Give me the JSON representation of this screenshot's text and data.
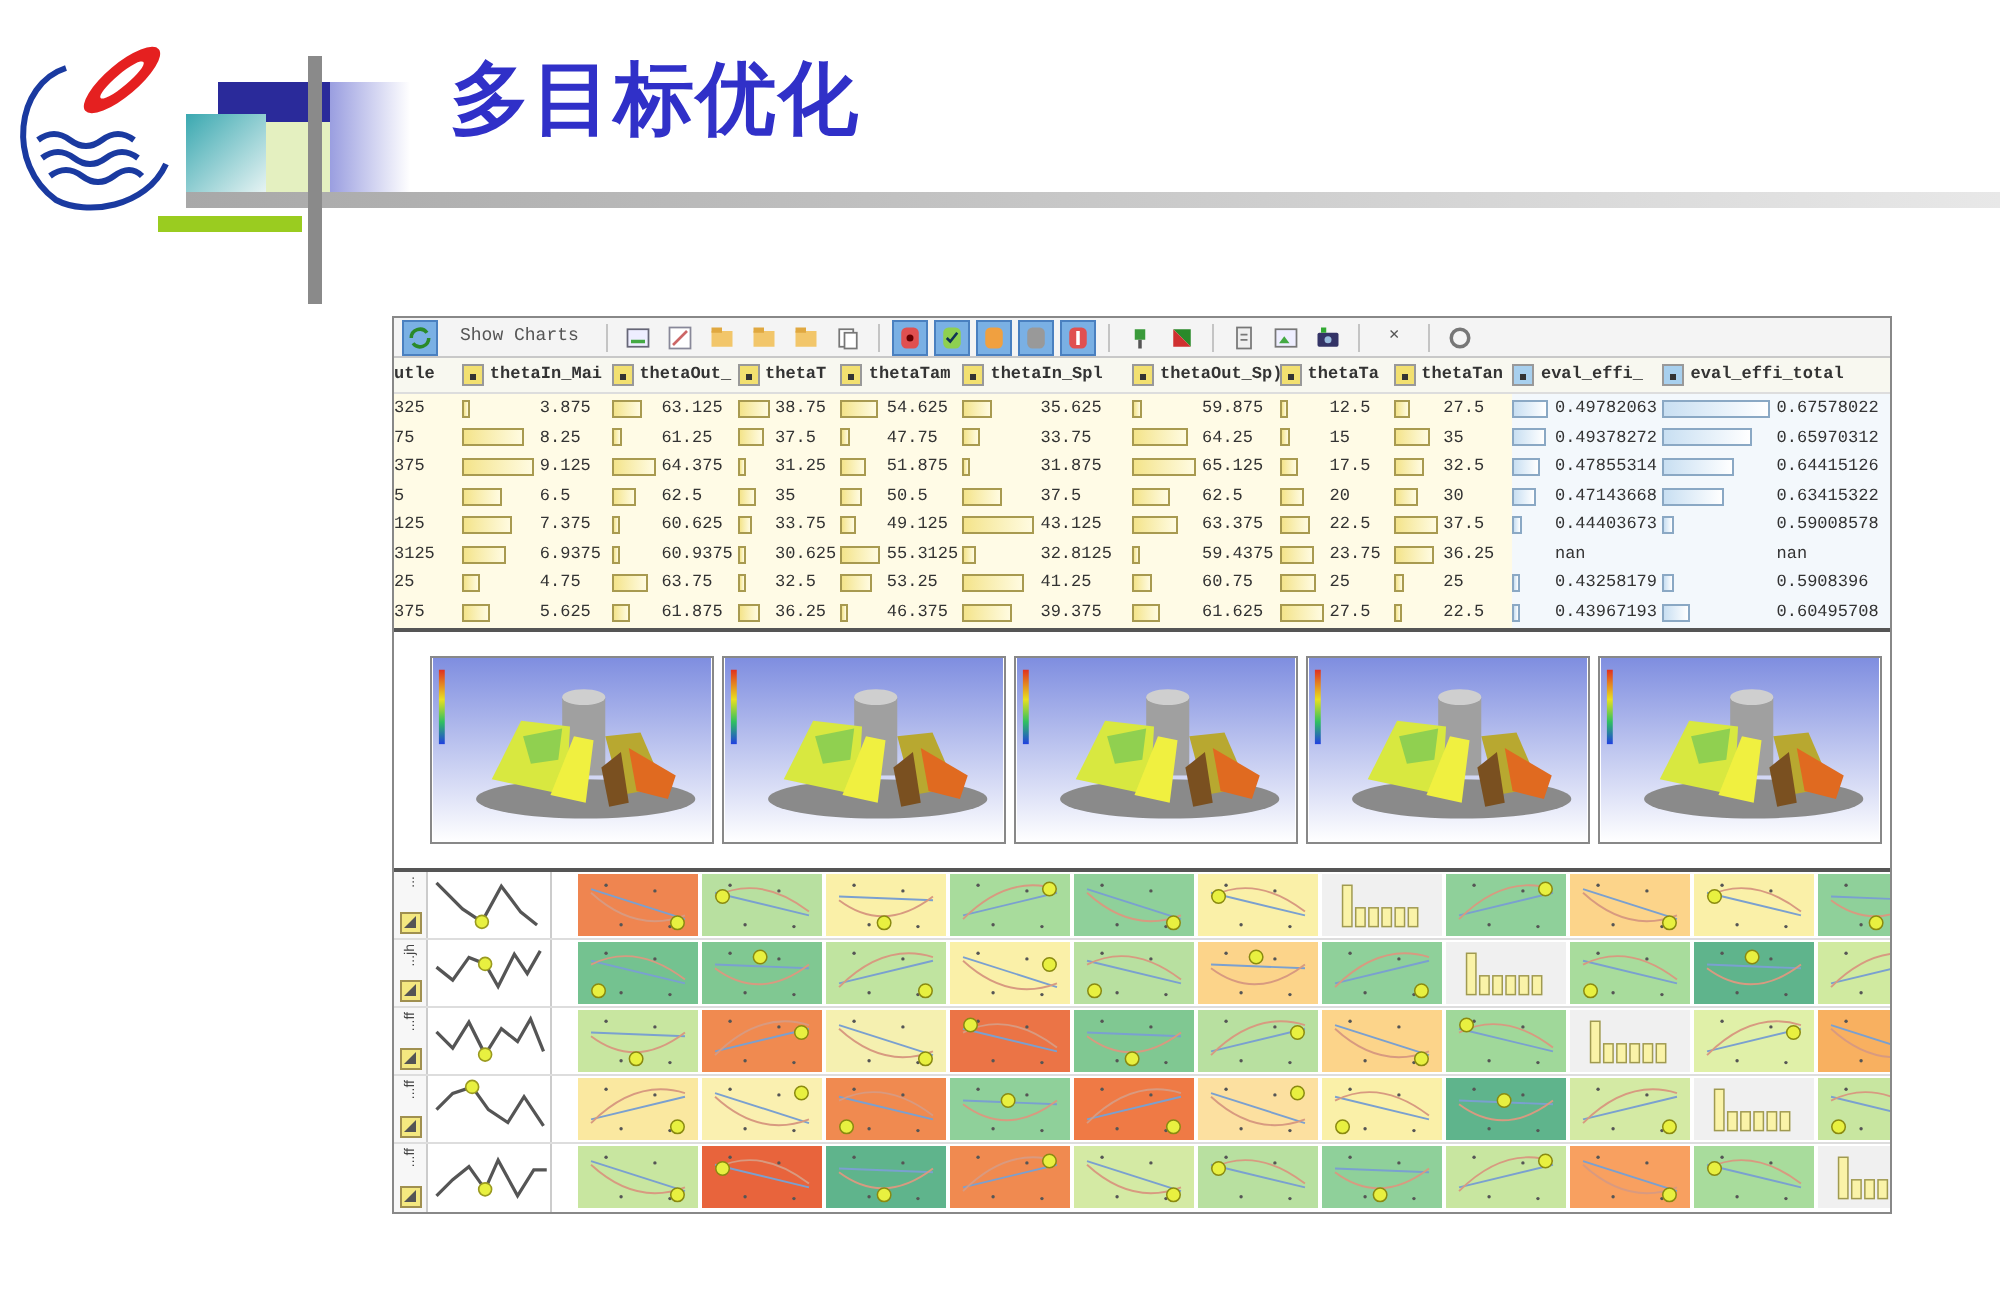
{
  "slide": {
    "title": "多目标优化"
  },
  "toolbar": [
    {
      "kind": "button",
      "on": true
    },
    {
      "kind": "text",
      "label": "Show Charts"
    },
    {
      "kind": "sep"
    },
    {
      "kind": "button",
      "on": false
    },
    {
      "kind": "button",
      "on": false
    },
    {
      "kind": "button",
      "on": false
    },
    {
      "kind": "button",
      "on": false
    },
    {
      "kind": "button",
      "on": false
    },
    {
      "kind": "button",
      "on": false
    },
    {
      "kind": "sep"
    },
    {
      "kind": "button",
      "on": true
    },
    {
      "kind": "button",
      "on": true
    },
    {
      "kind": "button",
      "on": true
    },
    {
      "kind": "button",
      "on": true
    },
    {
      "kind": "button",
      "on": true
    },
    {
      "kind": "sep"
    },
    {
      "kind": "button",
      "on": false
    },
    {
      "kind": "button",
      "on": false
    },
    {
      "kind": "sep"
    },
    {
      "kind": "button",
      "on": false
    },
    {
      "kind": "button",
      "on": false
    },
    {
      "kind": "button",
      "on": false
    },
    {
      "kind": "sep"
    },
    {
      "kind": "text",
      "label": "×"
    },
    {
      "kind": "sep"
    },
    {
      "kind": "button",
      "on": false
    }
  ],
  "table": {
    "columns": [
      {
        "label": "utle",
        "kind": "cut"
      },
      {
        "label": "thetaIn_Mai",
        "kind": "input"
      },
      {
        "label": "thetaOut_",
        "kind": "input"
      },
      {
        "label": "thetaT",
        "kind": "input"
      },
      {
        "label": "thetaTam",
        "kind": "input"
      },
      {
        "label": "thetaIn_Spl",
        "kind": "input"
      },
      {
        "label": "thetaOut_Sp)",
        "kind": "input"
      },
      {
        "label": "thetaTa",
        "kind": "input"
      },
      {
        "label": "thetaTan",
        "kind": "input"
      },
      {
        "label": "eval_effi_",
        "kind": "output"
      },
      {
        "label": "eval_effi_total",
        "kind": "output"
      }
    ],
    "rows": [
      [
        {
          "text": "325"
        },
        {
          "text": "3.875"
        },
        {
          "text": "63.125"
        },
        {
          "text": "38.75"
        },
        {
          "text": "54.625"
        },
        {
          "text": "35.625"
        },
        {
          "text": "59.875"
        },
        {
          "text": "12.5"
        },
        {
          "text": "27.5"
        },
        {
          "text": "0.49782063"
        },
        {
          "text": "0.67578022"
        }
      ],
      [
        {
          "text": "75"
        },
        {
          "text": "8.25"
        },
        {
          "text": "61.25"
        },
        {
          "text": "37.5"
        },
        {
          "text": "47.75"
        },
        {
          "text": "33.75"
        },
        {
          "text": "64.25"
        },
        {
          "text": "15"
        },
        {
          "text": "35"
        },
        {
          "text": "0.49378272"
        },
        {
          "text": "0.65970312"
        }
      ],
      [
        {
          "text": "375"
        },
        {
          "text": "9.125"
        },
        {
          "text": "64.375"
        },
        {
          "text": "31.25"
        },
        {
          "text": "51.875"
        },
        {
          "text": "31.875"
        },
        {
          "text": "65.125"
        },
        {
          "text": "17.5"
        },
        {
          "text": "32.5"
        },
        {
          "text": "0.47855314"
        },
        {
          "text": "0.64415126"
        }
      ],
      [
        {
          "text": "5"
        },
        {
          "text": "6.5"
        },
        {
          "text": "62.5"
        },
        {
          "text": "35"
        },
        {
          "text": "50.5"
        },
        {
          "text": "37.5"
        },
        {
          "text": "62.5"
        },
        {
          "text": "20"
        },
        {
          "text": "30"
        },
        {
          "text": "0.47143668"
        },
        {
          "text": "0.63415322"
        }
      ],
      [
        {
          "text": "125"
        },
        {
          "text": "7.375"
        },
        {
          "text": "60.625"
        },
        {
          "text": "33.75"
        },
        {
          "text": "49.125"
        },
        {
          "text": "43.125"
        },
        {
          "text": "63.375"
        },
        {
          "text": "22.5"
        },
        {
          "text": "37.5"
        },
        {
          "text": "0.44403673"
        },
        {
          "text": "0.59008578"
        }
      ],
      [
        {
          "text": "3125"
        },
        {
          "text": "6.9375"
        },
        {
          "text": "60.9375"
        },
        {
          "text": "30.625"
        },
        {
          "text": "55.3125"
        },
        {
          "text": "32.8125"
        },
        {
          "text": "59.4375"
        },
        {
          "text": "23.75"
        },
        {
          "text": "36.25"
        },
        {
          "text": "nan"
        },
        {
          "text": "nan"
        }
      ],
      [
        {
          "text": "25"
        },
        {
          "text": "4.75"
        },
        {
          "text": "63.75"
        },
        {
          "text": "32.5"
        },
        {
          "text": "53.25"
        },
        {
          "text": "41.25"
        },
        {
          "text": "60.75"
        },
        {
          "text": "25"
        },
        {
          "text": "25"
        },
        {
          "text": "0.43258179"
        },
        {
          "text": "0.5908396"
        }
      ],
      [
        {
          "text": "375"
        },
        {
          "text": "5.625"
        },
        {
          "text": "61.875"
        },
        {
          "text": "36.25"
        },
        {
          "text": "46.375"
        },
        {
          "text": "39.375"
        },
        {
          "text": "61.625"
        },
        {
          "text": "27.5"
        },
        {
          "text": "22.5"
        },
        {
          "text": "0.43967193"
        },
        {
          "text": "0.60495708"
        }
      ]
    ]
  },
  "matrix": {
    "rows": [
      {
        "label": "...",
        "cells": [
          {
            "kind": "scatter",
            "color": "#ef8550"
          },
          {
            "kind": "scatter",
            "color": "#b8e0a0"
          },
          {
            "kind": "scatter",
            "color": "#faf0a8"
          },
          {
            "kind": "scatter",
            "color": "#a8dc9c"
          },
          {
            "kind": "scatter",
            "color": "#8fd09a"
          },
          {
            "kind": "scatter",
            "color": "#faf0a8"
          },
          {
            "kind": "histogram",
            "color": "#f0f0f0"
          },
          {
            "kind": "scatter",
            "color": "#8fd09a"
          },
          {
            "kind": "scatter",
            "color": "#fcd48a"
          },
          {
            "kind": "scatter",
            "color": "#faf0a8"
          },
          {
            "kind": "scatter",
            "color": "#8fd09a"
          }
        ]
      },
      {
        "label": "...jh",
        "cells": [
          {
            "kind": "scatter",
            "color": "#74c290"
          },
          {
            "kind": "scatter",
            "color": "#80c892"
          },
          {
            "kind": "scatter",
            "color": "#c0e4a0"
          },
          {
            "kind": "scatter",
            "color": "#faf0a8"
          },
          {
            "kind": "scatter",
            "color": "#b8e0a0"
          },
          {
            "kind": "scatter",
            "color": "#fcd48a"
          },
          {
            "kind": "scatter",
            "color": "#8fd09a"
          },
          {
            "kind": "histogram",
            "color": "#f0f0f0"
          },
          {
            "kind": "scatter",
            "color": "#a8dc9c"
          },
          {
            "kind": "scatter",
            "color": "#5fb48c"
          },
          {
            "kind": "scatter",
            "color": "#d0eaa0"
          }
        ]
      },
      {
        "label": "...ff",
        "cells": [
          {
            "kind": "scatter",
            "color": "#c8e6a0"
          },
          {
            "kind": "scatter",
            "color": "#f08a50"
          },
          {
            "kind": "scatter",
            "color": "#f5f0b0"
          },
          {
            "kind": "scatter",
            "color": "#eb7446"
          },
          {
            "kind": "scatter",
            "color": "#80c892"
          },
          {
            "kind": "scatter",
            "color": "#b8e0a0"
          },
          {
            "kind": "scatter",
            "color": "#fcd48a"
          },
          {
            "kind": "scatter",
            "color": "#a0d89a"
          },
          {
            "kind": "histogram",
            "color": "#f0f0f0"
          },
          {
            "kind": "scatter",
            "color": "#e0f0a8"
          },
          {
            "kind": "scatter",
            "color": "#f8b060"
          }
        ]
      },
      {
        "label": "...ff",
        "cells": [
          {
            "kind": "scatter",
            "color": "#fae8a0"
          },
          {
            "kind": "scatter",
            "color": "#faf0b0"
          },
          {
            "kind": "scatter",
            "color": "#f08a50"
          },
          {
            "kind": "scatter",
            "color": "#8fd09a"
          },
          {
            "kind": "scatter",
            "color": "#ef7a45"
          },
          {
            "kind": "scatter",
            "color": "#fce0a0"
          },
          {
            "kind": "scatter",
            "color": "#faf0a8"
          },
          {
            "kind": "scatter",
            "color": "#5fb48c"
          },
          {
            "kind": "scatter",
            "color": "#d4eaa4"
          },
          {
            "kind": "histogram",
            "color": "#f0f0f0"
          },
          {
            "kind": "scatter",
            "color": "#c8e6a0"
          }
        ]
      },
      {
        "label": "...ff",
        "cells": [
          {
            "kind": "scatter",
            "color": "#c8e6a0"
          },
          {
            "kind": "scatter",
            "color": "#e8643c"
          },
          {
            "kind": "scatter",
            "color": "#5fb48c"
          },
          {
            "kind": "scatter",
            "color": "#f08a50"
          },
          {
            "kind": "scatter",
            "color": "#d4eaa4"
          },
          {
            "kind": "scatter",
            "color": "#b8e0a0"
          },
          {
            "kind": "scatter",
            "color": "#8fd09a"
          },
          {
            "kind": "scatter",
            "color": "#c8e6a0"
          },
          {
            "kind": "scatter",
            "color": "#f8a060"
          },
          {
            "kind": "scatter",
            "color": "#a8dc9c"
          },
          {
            "kind": "histogram",
            "color": "#f0f0f0"
          }
        ]
      }
    ]
  }
}
